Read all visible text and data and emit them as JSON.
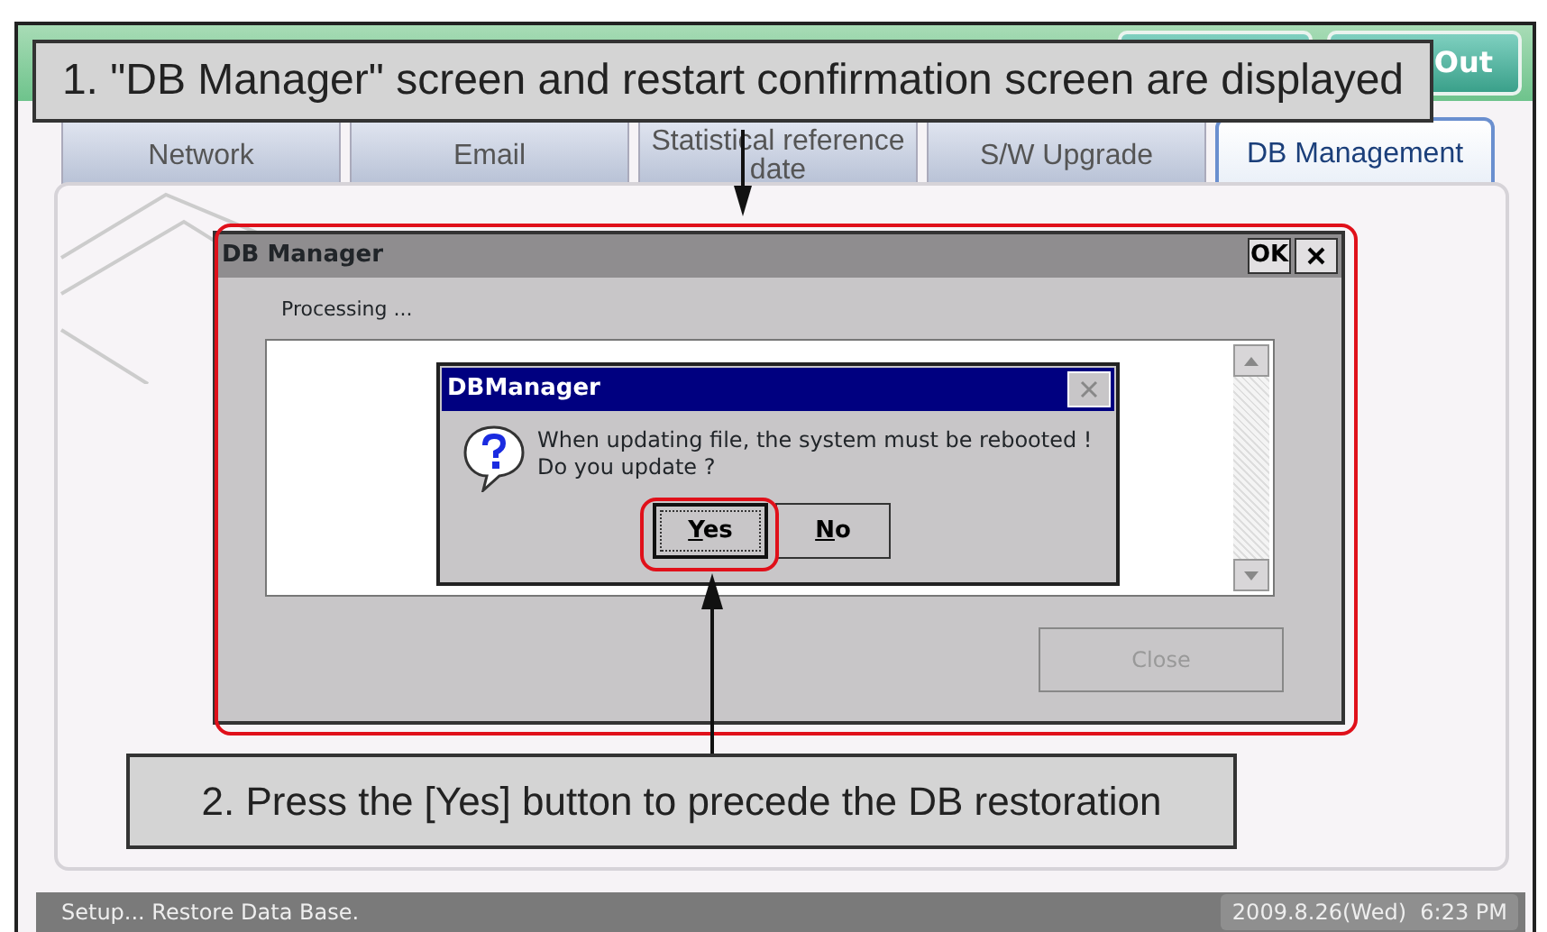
{
  "header": {
    "logout_button": "Out"
  },
  "tabs": [
    {
      "label": "Network",
      "selected": false
    },
    {
      "label": "Email",
      "selected": false
    },
    {
      "label": "Statistical reference date",
      "selected": false
    },
    {
      "label": "S/W Upgrade",
      "selected": false
    },
    {
      "label": "DB Management",
      "selected": true
    }
  ],
  "db_manager": {
    "title": "DB Manager",
    "ok_button": "OK",
    "status": "Processing ...",
    "close_button": {
      "label": "Close",
      "disabled": true
    },
    "highlighted": true
  },
  "dialog": {
    "title": "DBManager",
    "message": "When updating file, the system must be rebooted !\nDo you update ?",
    "buttons": [
      {
        "key": "Y",
        "rest": "es",
        "default": true,
        "highlighted": true
      },
      {
        "key": "N",
        "rest": "o",
        "default": false
      }
    ]
  },
  "callouts": [
    {
      "text": "1. \"DB Manager\" screen and restart confirmation screen are displayed"
    },
    {
      "text": "2. Press the [Yes] button to precede the DB restoration"
    }
  ],
  "status_bar": {
    "message": "Setup... Restore Data Base.",
    "datetime": "2009.8.26(Wed)  6:23 PM"
  }
}
